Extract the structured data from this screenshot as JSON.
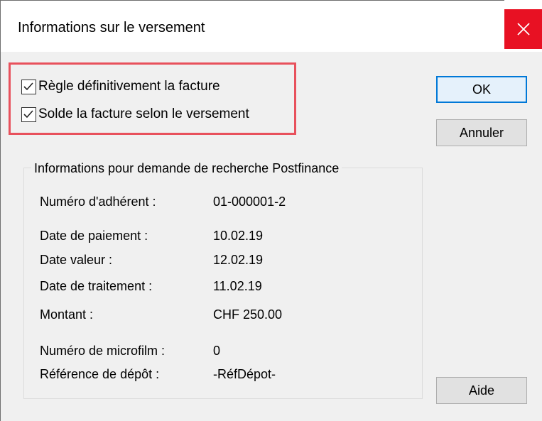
{
  "window": {
    "title": "Informations sur le versement",
    "close_icon": "close-icon"
  },
  "options": {
    "regle_definitivement": {
      "label": "Règle définitivement la facture",
      "checked": true
    },
    "solde_facture": {
      "label": "Solde la facture selon le versement",
      "checked": true
    }
  },
  "buttons": {
    "ok": "OK",
    "annuler": "Annuler",
    "aide": "Aide"
  },
  "group": {
    "title": "Informations pour demande de recherche Postfinance",
    "fields": [
      {
        "label": "Numéro d'adhérent :",
        "value": "01-000001-2"
      },
      {
        "label": "Date de paiement :",
        "value": "10.02.19"
      },
      {
        "label": "Date valeur :",
        "value": "12.02.19"
      },
      {
        "label": "Date de traitement :",
        "value": "11.02.19"
      },
      {
        "label": "Montant :",
        "value": "CHF 250.00"
      },
      {
        "label": "Numéro de microfilm :",
        "value": "0"
      },
      {
        "label": "Référence de dépôt :",
        "value": "-RéfDépot-"
      }
    ]
  },
  "colors": {
    "close_bg": "#e81123",
    "highlight": "#e8515c",
    "default_button_border": "#0078d7",
    "dialog_bg": "#f0f0f0"
  }
}
